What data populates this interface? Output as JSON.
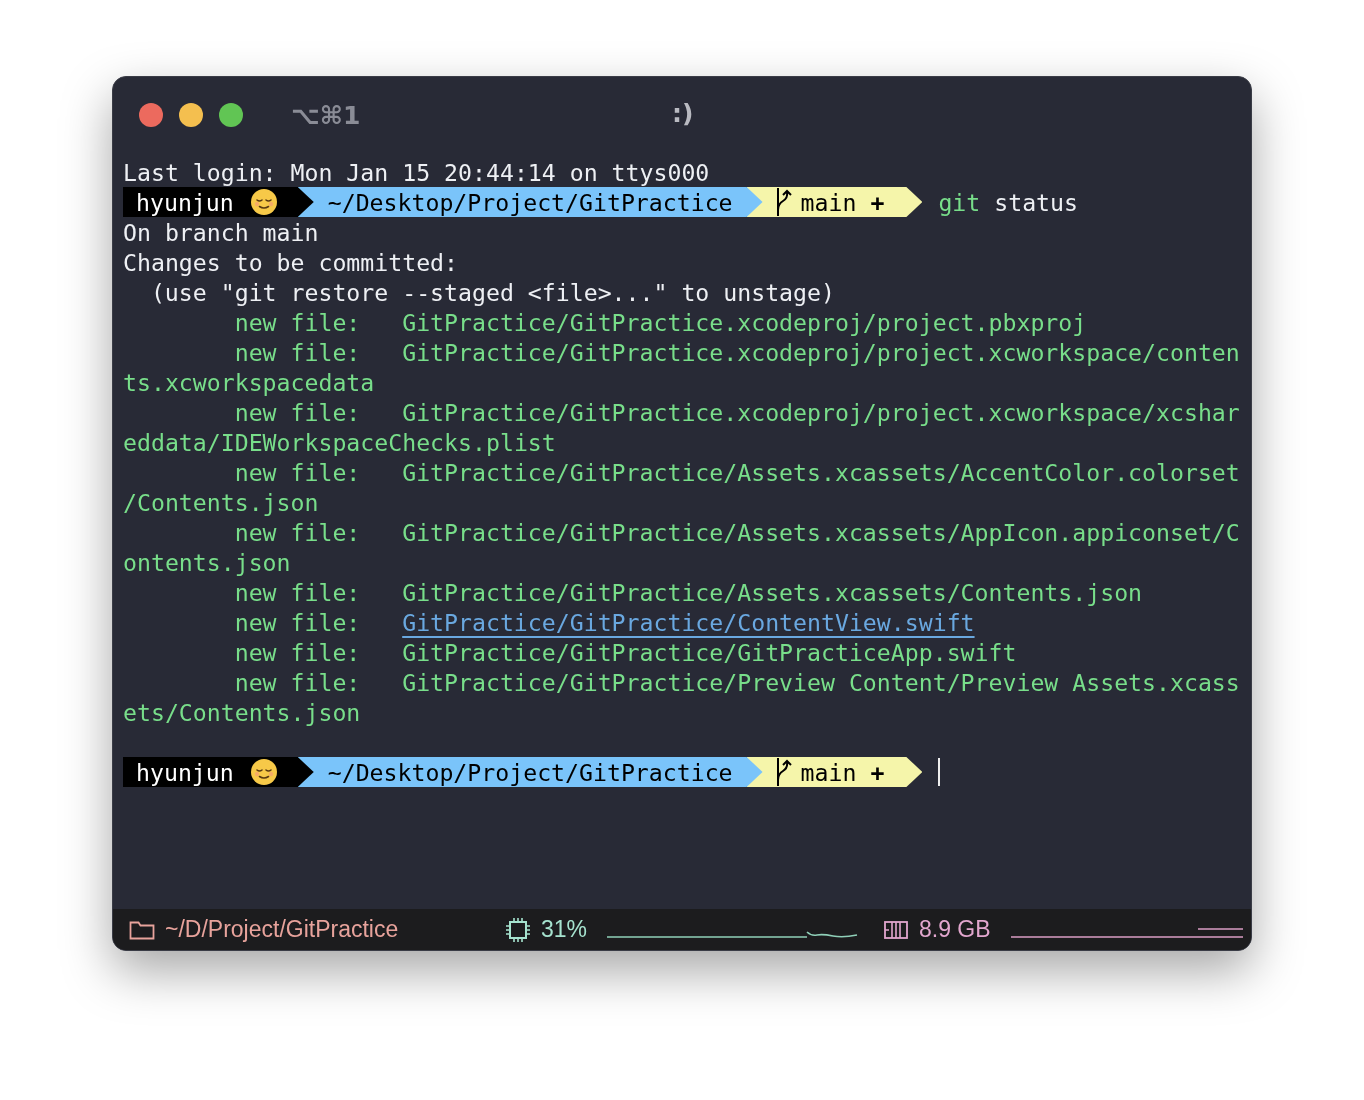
{
  "window": {
    "shortcut": "⌥⌘1",
    "title": ":)"
  },
  "terminal": {
    "lines": [
      {
        "kind": "text",
        "text": "Last login: Mon Jan 15 20:44:14 on ttys000"
      },
      {
        "kind": "prompt",
        "user": "hyunjun",
        "path": "~/Desktop/Project/GitPractice",
        "branch": "main",
        "mark": "+",
        "command": "git",
        "args": "status",
        "cursor": false
      },
      {
        "kind": "text",
        "text": "On branch main"
      },
      {
        "kind": "text",
        "text": "Changes to be committed:"
      },
      {
        "kind": "hint",
        "text": "(use \"git restore --staged <file>...\" to unstage)"
      },
      {
        "kind": "entry",
        "label": "new file:",
        "path": "GitPractice/GitPractice.xcodeproj/project.pbxproj",
        "link": false
      },
      {
        "kind": "entry",
        "label": "new file:",
        "path": "GitPractice/GitPractice.xcodeproj/project.xcworkspace/conten",
        "link": false
      },
      {
        "kind": "wrap",
        "text": "ts.xcworkspacedata"
      },
      {
        "kind": "entry",
        "label": "new file:",
        "path": "GitPractice/GitPractice.xcodeproj/project.xcworkspace/xcshar",
        "link": false
      },
      {
        "kind": "wrap",
        "text": "eddata/IDEWorkspaceChecks.plist"
      },
      {
        "kind": "entry",
        "label": "new file:",
        "path": "GitPractice/GitPractice/Assets.xcassets/AccentColor.colorset",
        "link": false
      },
      {
        "kind": "wrap",
        "text": "/Contents.json"
      },
      {
        "kind": "entry",
        "label": "new file:",
        "path": "GitPractice/GitPractice/Assets.xcassets/AppIcon.appiconset/C",
        "link": false
      },
      {
        "kind": "wrap",
        "text": "ontents.json"
      },
      {
        "kind": "entry",
        "label": "new file:",
        "path": "GitPractice/GitPractice/Assets.xcassets/Contents.json",
        "link": false
      },
      {
        "kind": "entry",
        "label": "new file:",
        "path": "GitPractice/GitPractice/ContentView.swift",
        "link": true
      },
      {
        "kind": "entry",
        "label": "new file:",
        "path": "GitPractice/GitPractice/GitPracticeApp.swift",
        "link": false
      },
      {
        "kind": "entry",
        "label": "new file:",
        "path": "GitPractice/GitPractice/Preview Content/Preview Assets.xcass",
        "link": false
      },
      {
        "kind": "wrap",
        "text": "ets/Contents.json"
      },
      {
        "kind": "blank"
      },
      {
        "kind": "prompt",
        "user": "hyunjun",
        "path": "~/Desktop/Project/GitPractice",
        "branch": "main",
        "mark": "+",
        "cursor": true
      }
    ]
  },
  "status_bar": {
    "path": "~/D/Project/GitPractice",
    "cpu": "31%",
    "memory": "8.9 GB"
  }
}
